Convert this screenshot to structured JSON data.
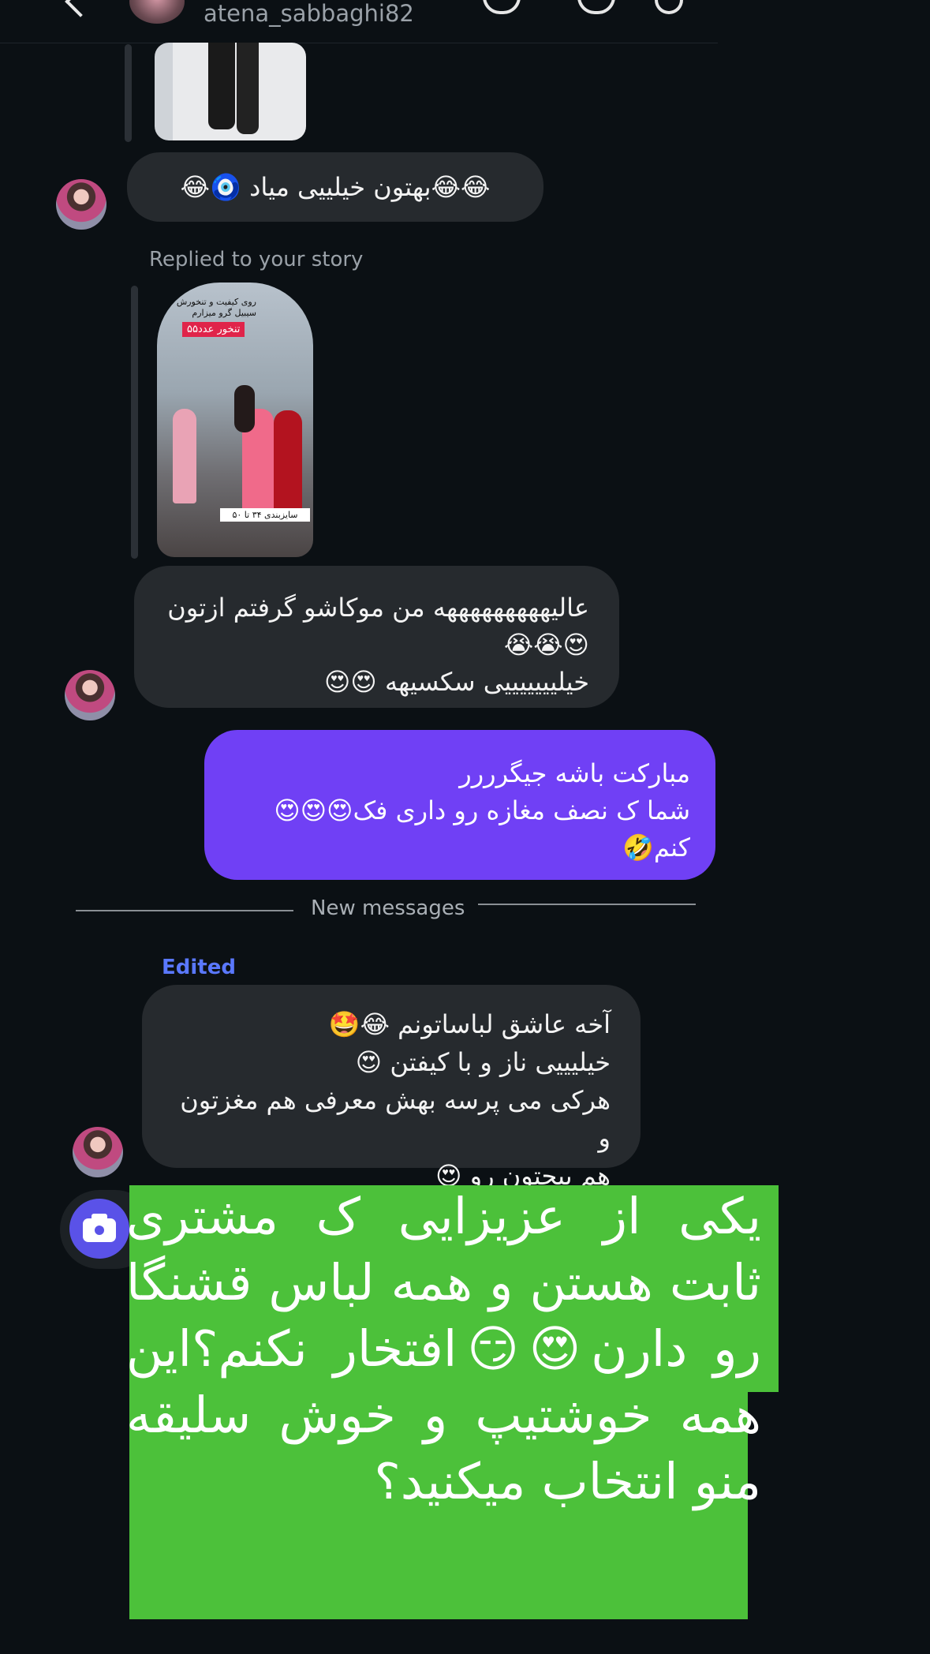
{
  "header": {
    "username": "atena_sabbaghi82",
    "back_icon": "chevron-left-icon",
    "call_icon": "phone-icon",
    "video_icon": "video-icon",
    "flag_icon": "flag-icon"
  },
  "messages": {
    "incoming_1": "😂😂بهتون خیلییی میاد 🧿😂",
    "replied_label": "Replied to your story",
    "story_badge": "تنخور عدد۵۵",
    "story_caption_top": "روی کیفیت و تنخورش سیبیل گرو میزارم",
    "story_caption_bottom": "سایزبندی ۳۴ تا ۵۰",
    "incoming_2_line1": "عالیهههههههههه من موکاشو گرفتم ازتون",
    "incoming_2_line2": "😍😭😭",
    "incoming_2_line3": "خیلیییییییی سکسیهه 😍😍",
    "outgoing_line1": "مبارکت باشه جیگرررر",
    "outgoing_line2": "شما ک نصف مغازه رو داری فک😍😍😍",
    "outgoing_line3": "کنم🤣",
    "new_messages_label": "New messages",
    "edited_label": "Edited",
    "incoming_3_line1": "آخه عاشق لباساتونم 😂🤩",
    "incoming_3_line2": "خیلیییی ناز و با کیفتن 😍",
    "incoming_3_line3": "هرکی می پرسه بهش معرفی هم مغزتون و",
    "incoming_3_line4": "هم پیجتون رو 😍"
  },
  "overlay": {
    "text": "یکی از عزیزایی ک مشتری ثابت هستن و همه لباس قشنگا رو دارن😍😏افتخار نکنم؟این همه خوشتیپ و خوش سلیقه منو انتخاب میکنید؟",
    "color": "#4cc13a"
  },
  "composer": {
    "camera_icon": "camera-icon"
  },
  "colors": {
    "background": "#0b1014",
    "incoming_bubble": "#262a2e",
    "outgoing_bubble": "#7040f5",
    "edited": "#5a78ff"
  }
}
